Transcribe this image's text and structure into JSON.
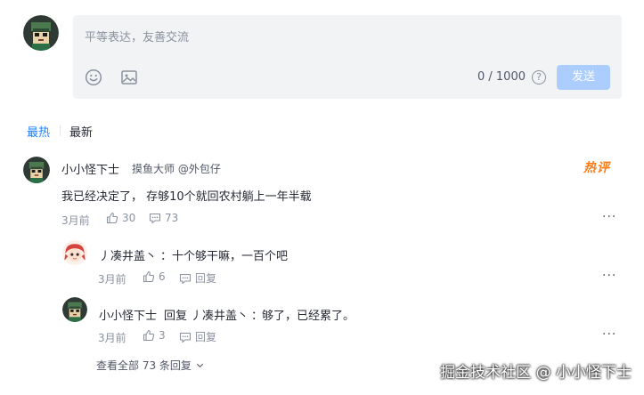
{
  "composer": {
    "placeholder": "平等表达，友善交流",
    "counter": "0 / 1000",
    "help": "?",
    "send_label": "发送"
  },
  "sort_tabs": [
    {
      "label": "最热",
      "active": true
    },
    {
      "label": "最新",
      "active": false
    }
  ],
  "comment": {
    "author": "小小怪下士",
    "badge": "摸鱼大师 @外包仔",
    "hot_tag": "热评",
    "text": "我已经决定了， 存够10个就回农村躺上一年半载",
    "time": "3月前",
    "likes": "30",
    "replies": "73",
    "more": "···"
  },
  "replies": [
    {
      "author": "丿凑井盖丶",
      "separator": "：",
      "text": "十个够干嘛，一百个吧",
      "time": "3月前",
      "likes": "6",
      "reply_label": "回复",
      "more": "···"
    },
    {
      "author": "小小怪下士",
      "reply_word": "回复",
      "reply_to": "丿凑井盖丶",
      "separator": "：",
      "text": "够了，已经累了。",
      "time": "3月前",
      "likes": "3",
      "reply_label": "回复",
      "more": "···"
    }
  ],
  "view_all": "查看全部 73 条回复",
  "watermark": "掘金技术社区 @ 小小怪下士",
  "colors": {
    "accent": "#1e80ff",
    "send_disabled": "#abcdff",
    "hot": "#ff7a14",
    "composer_bg": "#f2f3f5"
  },
  "icons": [
    "emoji-icon",
    "image-icon",
    "help-icon",
    "like-icon",
    "comment-icon",
    "chevron-down-icon",
    "more-icon"
  ]
}
